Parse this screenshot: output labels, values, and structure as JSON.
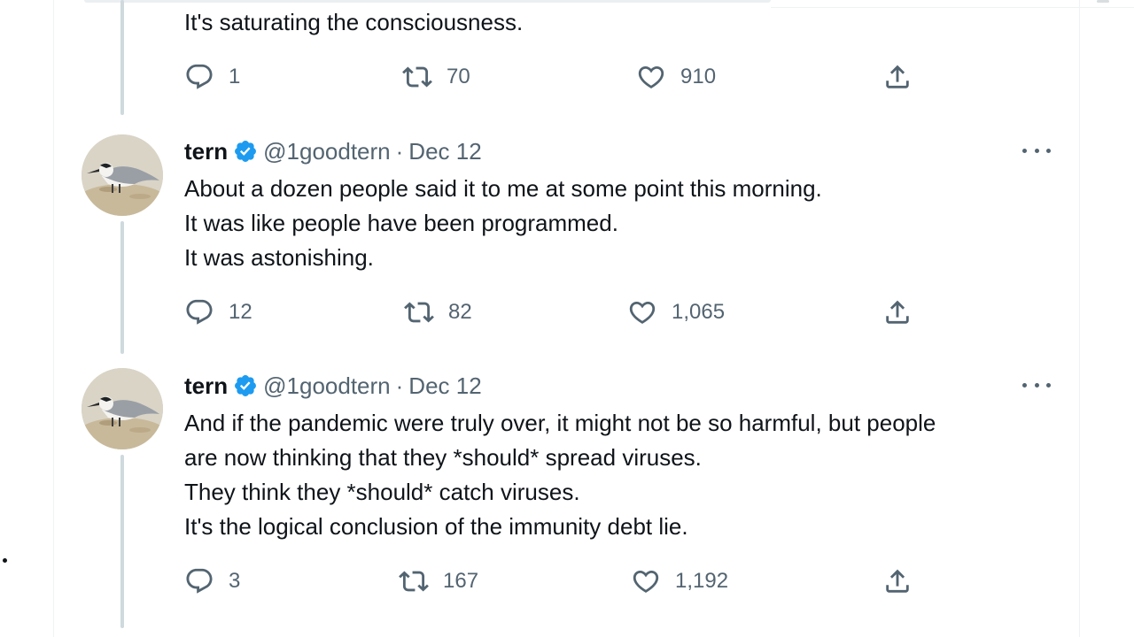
{
  "tweets": [
    {
      "lines": [
        "It's saturating the consciousness."
      ],
      "actions": {
        "replies": "1",
        "retweets": "70",
        "likes": "910"
      }
    },
    {
      "author": {
        "name": "tern",
        "handle": "@1goodtern",
        "separator": "·",
        "date": "Dec 12"
      },
      "lines": [
        "About a dozen people said it to me at some point this morning.",
        "It was like people have been programmed.",
        "It was astonishing."
      ],
      "actions": {
        "replies": "12",
        "retweets": "82",
        "likes": "1,065"
      }
    },
    {
      "author": {
        "name": "tern",
        "handle": "@1goodtern",
        "separator": "·",
        "date": "Dec 12"
      },
      "lines": [
        "And if the pandemic were truly over, it might not be so harmful, but people",
        "are now thinking that they *should* spread viruses.",
        "They think they *should* catch viruses.",
        "It's the logical conclusion of the immunity debt lie."
      ],
      "actions": {
        "replies": "3",
        "retweets": "167",
        "likes": "1,192"
      }
    }
  ],
  "colors": {
    "verified": "#1d9bf0",
    "muted": "#536471",
    "text": "#0f1419",
    "thread_line": "#cfd9de"
  },
  "icons": [
    "reply-icon",
    "retweet-icon",
    "like-icon",
    "share-icon",
    "more-icon",
    "verified-badge-icon"
  ]
}
